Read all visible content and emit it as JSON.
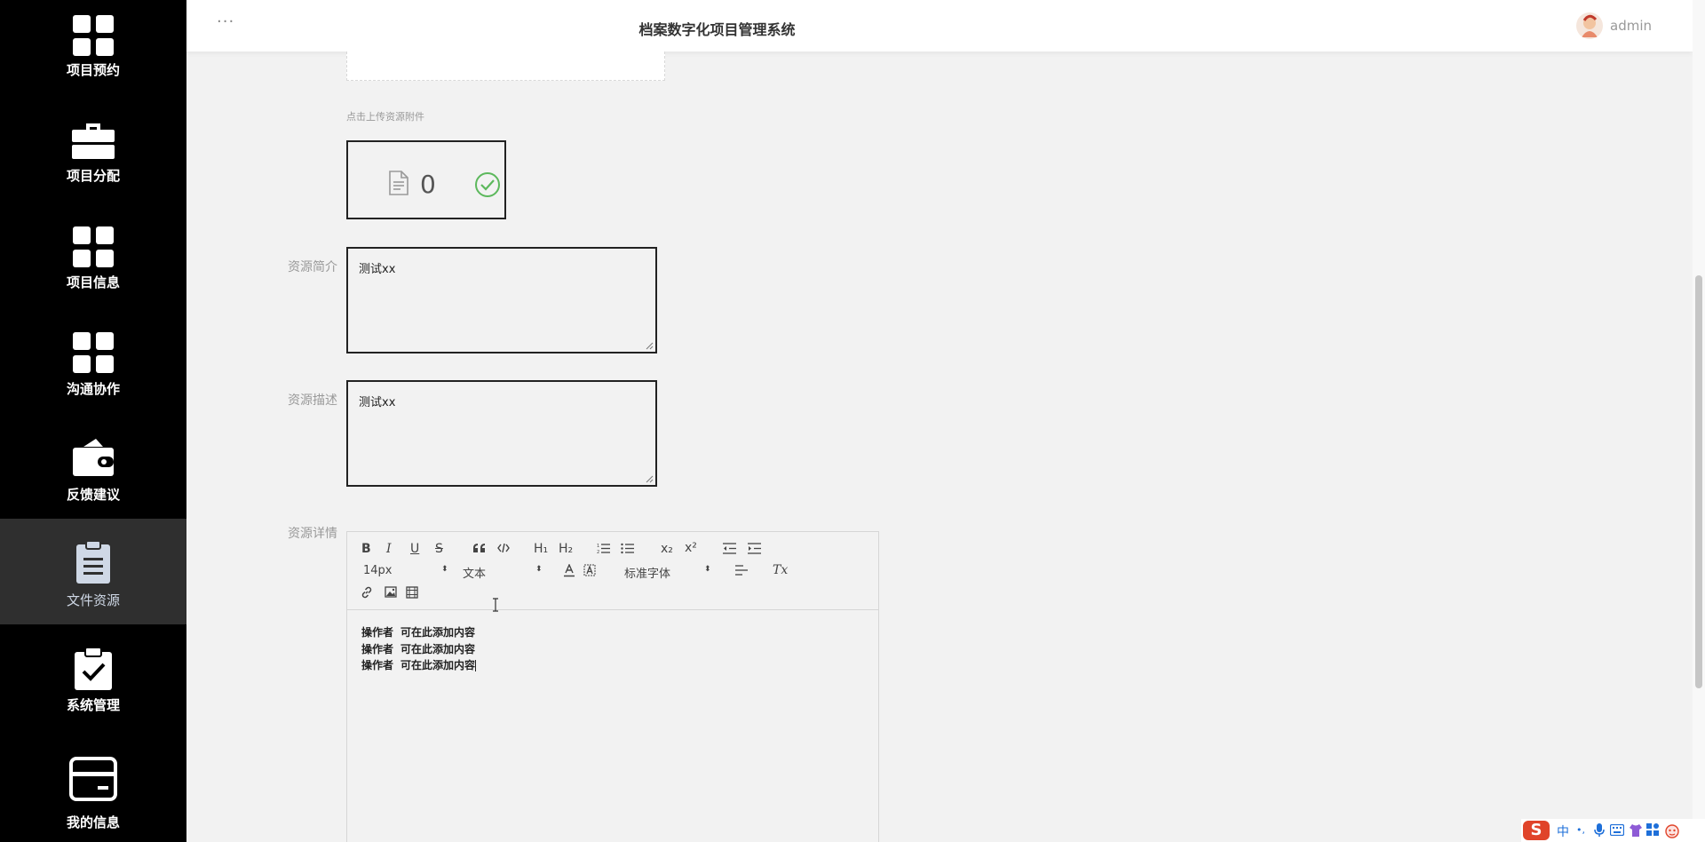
{
  "app": {
    "title": "档案数字化项目管理系统",
    "username": "admin",
    "more_label": "···"
  },
  "sidebar": {
    "items": [
      {
        "label": "项目预约",
        "icon": "grid-icon"
      },
      {
        "label": "项目分配",
        "icon": "briefcase-icon"
      },
      {
        "label": "项目信息",
        "icon": "grid-icon"
      },
      {
        "label": "沟通协作",
        "icon": "grid-icon"
      },
      {
        "label": "反馈建议",
        "icon": "wallet-icon"
      },
      {
        "label": "文件资源",
        "icon": "clipboard-icon",
        "active": true
      },
      {
        "label": "系统管理",
        "icon": "clipboard-check-icon"
      },
      {
        "label": "我的信息",
        "icon": "card-icon"
      }
    ]
  },
  "form": {
    "upload_hint": "点击上传资源附件",
    "upload_count": "0",
    "intro": {
      "label": "资源简介",
      "value": "测试xx"
    },
    "description": {
      "label": "资源描述",
      "value": "测试xx"
    },
    "details": {
      "label": "资源详情"
    }
  },
  "editor": {
    "toolbar": {
      "bold": "B",
      "italic": "I",
      "underline": "U",
      "strike": "S",
      "h1": "H₁",
      "h2": "H₂",
      "subscript": "x₂",
      "superscript": "x²",
      "font_size": "14px",
      "block_format": "文本",
      "font_family": "标准字体",
      "clear_format": "Tx"
    },
    "lines": [
      {
        "user": "操作者",
        "text": "可在此添加内容"
      },
      {
        "user": "操作者",
        "text": "可在此添加内容"
      },
      {
        "user": "操作者",
        "text": "可在此添加内容"
      }
    ]
  },
  "tray": {
    "logo": "S",
    "ime": "中",
    "punct": "•,"
  },
  "colors": {
    "sidebar_bg": "#000000",
    "sidebar_active": "#2f2f2f",
    "check_green": "#5cb85c",
    "tray_red": "#e0442a"
  }
}
